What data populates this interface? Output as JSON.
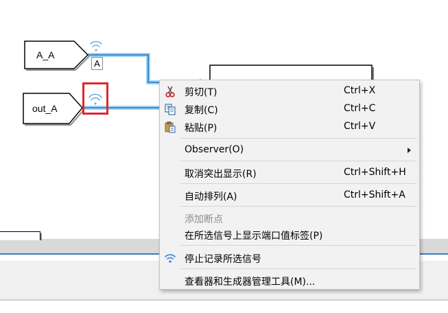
{
  "diagram": {
    "inports": [
      {
        "name": "A_A"
      },
      {
        "name": "out_A"
      }
    ],
    "signal_label": "A"
  },
  "context_menu": {
    "items": [
      {
        "id": "cut",
        "label": "剪切(T)",
        "shortcut": "Ctrl+X",
        "icon": "scissors-icon",
        "enabled": true
      },
      {
        "id": "copy",
        "label": "复制(C)",
        "shortcut": "Ctrl+C",
        "icon": "copy-icon",
        "enabled": true
      },
      {
        "id": "paste",
        "label": "粘贴(P)",
        "shortcut": "Ctrl+V",
        "icon": "paste-icon",
        "enabled": true
      },
      {
        "id": "observer",
        "label": "Observer(O)",
        "shortcut": "",
        "icon": "",
        "submenu": true,
        "enabled": true
      },
      {
        "id": "remove-highlight",
        "label": "取消突出显示(R)",
        "shortcut": "Ctrl+Shift+H",
        "icon": "",
        "enabled": true
      },
      {
        "id": "auto-arrange",
        "label": "自动排列(A)",
        "shortcut": "Ctrl+Shift+A",
        "icon": "",
        "enabled": true
      },
      {
        "id": "add-breakpoint",
        "label": "添加断点",
        "shortcut": "",
        "icon": "",
        "enabled": false
      },
      {
        "id": "show-port-value-label",
        "label": "在所选信号上显示端口值标签(P)",
        "shortcut": "",
        "icon": "",
        "enabled": true
      },
      {
        "id": "stop-logging",
        "label": "停止记录所选信号",
        "shortcut": "",
        "icon": "signal-logging-icon",
        "enabled": true
      },
      {
        "id": "viewers-generators",
        "label": "查看器和生成器管理工具(M)...",
        "shortcut": "",
        "icon": "",
        "enabled": true
      }
    ]
  },
  "colors": {
    "signal_line": "#1e6fc0",
    "signal_selected_glow": "#9fd4f5",
    "logging_icon": "#6fb2e8",
    "highlight_box": "#e3242b",
    "menu_background": "#f2f2f2"
  }
}
